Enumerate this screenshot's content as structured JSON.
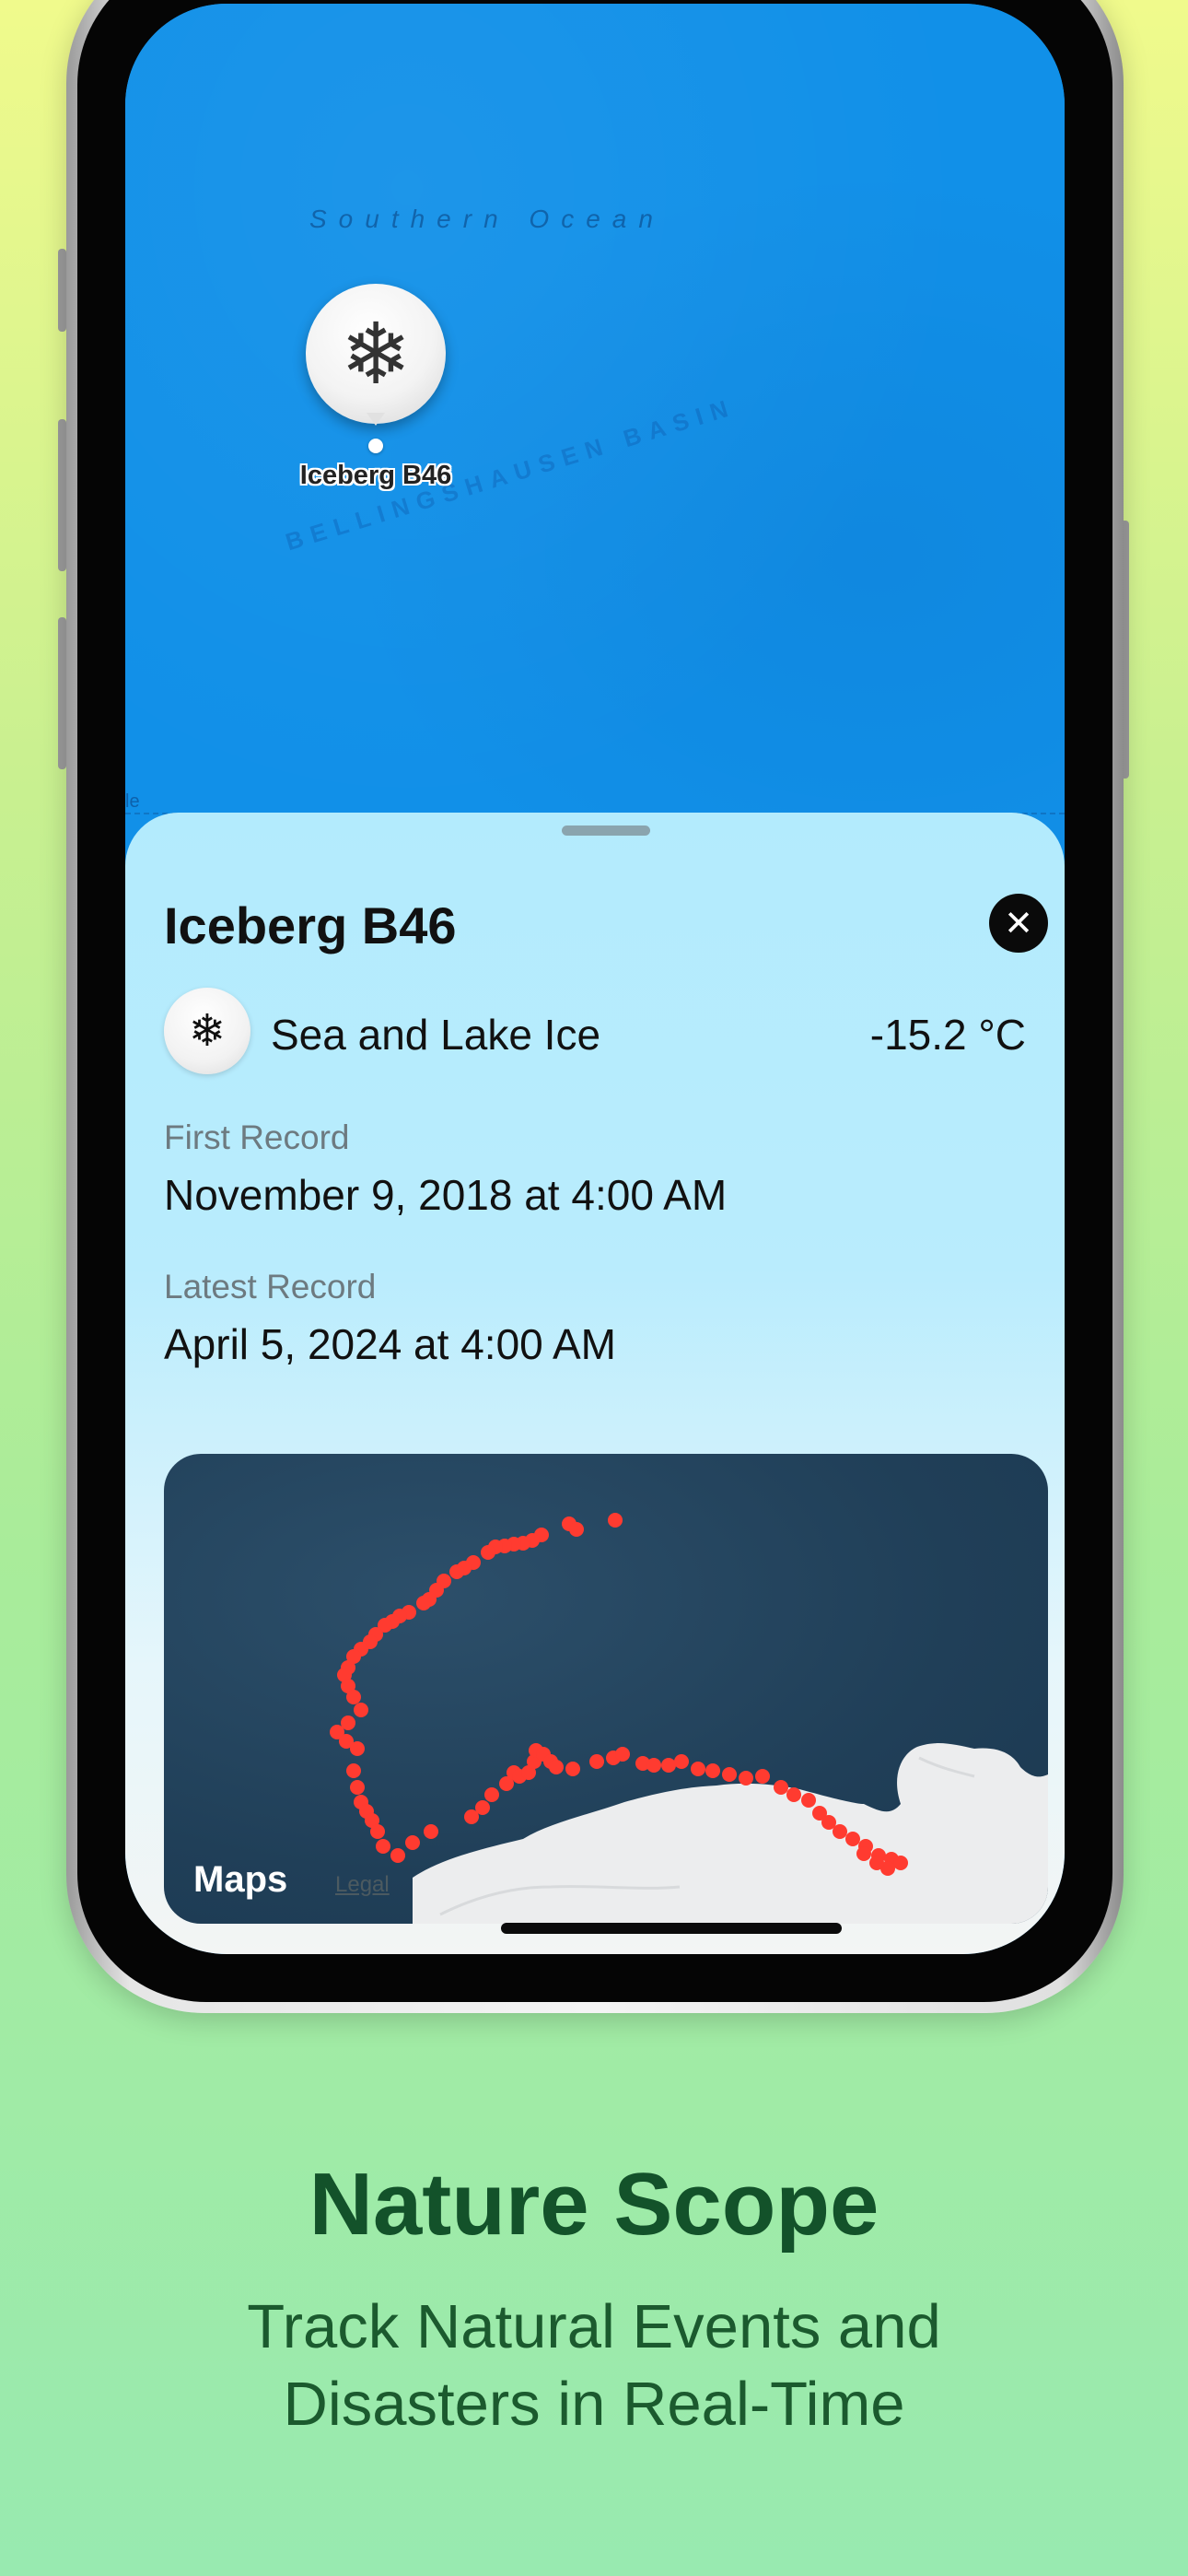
{
  "map": {
    "ocean_label": "Southern Ocean",
    "basin_label": "BELLINGSHAUSEN BASIN",
    "edge_mark": "le",
    "pin": {
      "icon": "snowflake-icon",
      "glyph": "❄",
      "label": "Iceberg B46"
    }
  },
  "sheet": {
    "title": "Iceberg B46",
    "close_glyph": "✕",
    "category": {
      "icon": "snowflake-icon",
      "glyph": "❄",
      "label": "Sea and Lake Ice"
    },
    "temperature": "-15.2 °C",
    "first_record": {
      "label": "First Record",
      "value": "November 9, 2018 at 4:00 AM"
    },
    "latest_record": {
      "label": "Latest Record",
      "value": "April 5, 2024 at 4:00 AM"
    },
    "mini_map": {
      "brand": "Maps",
      "apple_glyph": "",
      "legal": "Legal",
      "track_color": "#ff3b30"
    }
  },
  "marketing": {
    "app_name": "Nature Scope",
    "tagline_line1": "Track Natural Events and",
    "tagline_line2": "Disasters in Real-Time"
  },
  "colors": {
    "accent_text": "#13522a",
    "map_water": "#1190e8"
  }
}
